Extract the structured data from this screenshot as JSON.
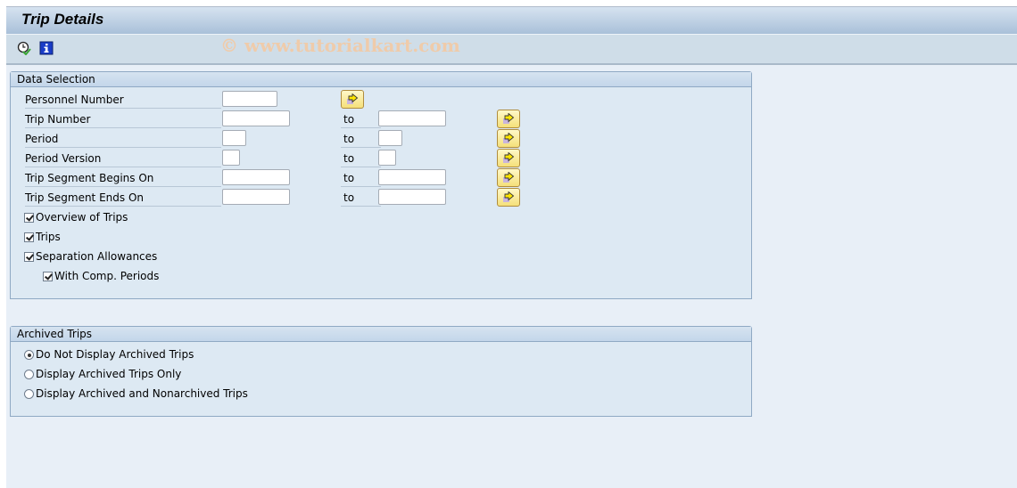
{
  "window": {
    "title": "Trip Details",
    "watermark": "© www.tutorialkart.com"
  },
  "toolbar": {
    "items": [
      {
        "icon": "execute-clock-icon",
        "label": "Execute"
      },
      {
        "icon": "info-icon",
        "label": "Information"
      }
    ]
  },
  "data_selection": {
    "header": "Data Selection",
    "fields": [
      {
        "label": "Personnel Number",
        "value": "",
        "has_to": false
      },
      {
        "label": "Trip Number",
        "value": "",
        "to_label": "to",
        "to_value": "",
        "has_to": true
      },
      {
        "label": "Period",
        "value": "",
        "to_label": "to",
        "to_value": "",
        "has_to": true
      },
      {
        "label": "Period Version",
        "value": "",
        "to_label": "to",
        "to_value": "",
        "has_to": true
      },
      {
        "label": "Trip Segment Begins On",
        "value": "",
        "to_label": "to",
        "to_value": "",
        "has_to": true
      },
      {
        "label": "Trip Segment Ends On",
        "value": "",
        "to_label": "to",
        "to_value": "",
        "has_to": true
      }
    ],
    "checkboxes": [
      {
        "label": "Overview of Trips",
        "checked": true
      },
      {
        "label": "Trips",
        "checked": true
      },
      {
        "label": "Separation Allowances",
        "checked": true
      },
      {
        "label": "With Comp. Periods",
        "checked": true
      }
    ]
  },
  "archived_trips": {
    "header": "Archived Trips",
    "options": [
      {
        "label": "Do Not Display Archived Trips",
        "selected": true
      },
      {
        "label": "Display Archived Trips Only",
        "selected": false
      },
      {
        "label": "Display Archived and Nonarchived Trips",
        "selected": false
      }
    ]
  },
  "colors": {
    "background": "#e8eff7",
    "group_bg": "#dde9f3",
    "multi_button": "#f5e07a"
  }
}
